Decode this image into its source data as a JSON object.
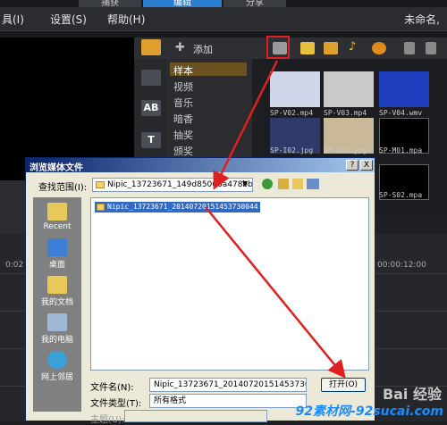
{
  "menubar": {
    "items": [
      "具(I)",
      "设置(S)",
      "帮助(H)"
    ],
    "tabs": [
      "捕获",
      "编辑",
      "分享"
    ],
    "project_title": "未命名,"
  },
  "library": {
    "add_label": "添加",
    "categories": [
      "样本",
      "视频",
      "音乐",
      "暗香",
      "抽奖",
      "颁奖"
    ],
    "selected_category": "样本",
    "thumbnails": [
      {
        "label": "SP-V02.mp4",
        "color": "#cfd6e8"
      },
      {
        "label": "SP-V03.mp4",
        "color": "#c9c9c9"
      },
      {
        "label": "SP-V04.wmv",
        "color": "#1f3fbf"
      },
      {
        "label": "SP-I02.jpg",
        "color": "#2f3a6a"
      },
      {
        "label": "SP-I03.jpg",
        "color": "#c9b89a"
      },
      {
        "label": "SP-M01.mpa",
        "color": "#000000"
      },
      {
        "label": "SP-S02.mpa",
        "color": "#000000"
      }
    ]
  },
  "timeline": {
    "ticks": [
      "0:02",
      "00:00:12:00"
    ]
  },
  "dialog": {
    "title": "浏览媒体文件",
    "close": "X",
    "help": "?",
    "look_in_label": "查找范围(I):",
    "look_in_value": "Nipic_13723671_149d85066a478bb",
    "places": [
      "Recent",
      "桌面",
      "我的文档",
      "我的电脑",
      "网上邻居"
    ],
    "selected_file": "Nipic_13723671_20140720151453730044",
    "filename_label": "文件名(N):",
    "filename_value": "Nipic_13723671_20140720151453730044",
    "filetype_label": "文件类型(T):",
    "filetype_value": "所有格式",
    "subject_label": "主题(U):",
    "open_button": "打开(O)"
  },
  "watermark": {
    "line1": "Bai 经验",
    "line2": "92素材网-92sucai.com"
  },
  "colors": {
    "arrow": "#e02020",
    "selection": "#316ac5",
    "accent": "#6b5221"
  }
}
